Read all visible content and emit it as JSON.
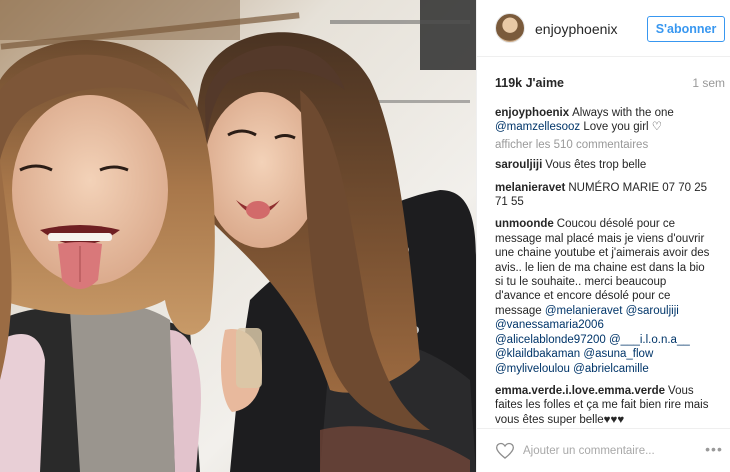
{
  "post": {
    "username": "enjoyphoenix",
    "follow_label": "S'abonner",
    "likes": "119k J'aime",
    "time": "1 sem",
    "caption_user": "enjoyphoenix",
    "caption_text": "Always with the one",
    "caption_mention": "@mamzellesooz",
    "caption_rest": "Love you girl ♡",
    "load_more": "afficher les 510 commentaires",
    "add_comment_placeholder": "Ajouter un commentaire...",
    "more_icon": "•••"
  },
  "comments": [
    {
      "user": "sarouljiji",
      "text": "Vous êtes trop belle"
    },
    {
      "user": "melanieravet",
      "text": "NUMÉRO MARIE 07 70 25 71 55"
    },
    {
      "user": "unmoonde",
      "text": "Coucou désolé pour ce message mal placé mais je viens d'ouvrir une chaine youtube et j'aimerais avoir des avis.. le lien de ma chaine est dans la bio si tu le souhaite.. merci beaucoup d'avance et encore désolé pour ce message",
      "mentions": [
        "@melanieravet",
        "@sarouljiji",
        "@vanessamaria2006",
        "@alicelablonde97200",
        "@___i.l.o.n.a__",
        "@klaildbakaman",
        "@asuna_flow",
        "@myliveloulou",
        "@abrielcamille"
      ]
    },
    {
      "user": "emma.verde.i.love.emma.verde",
      "text": "Vous faites les folles et ça me fait bien rire mais vous êtes super belle♥♥♥"
    }
  ],
  "colors": {
    "follow_blue": "#3897f0",
    "mention_blue": "#003569",
    "muted_gray": "#999999",
    "border": "#efefef"
  }
}
